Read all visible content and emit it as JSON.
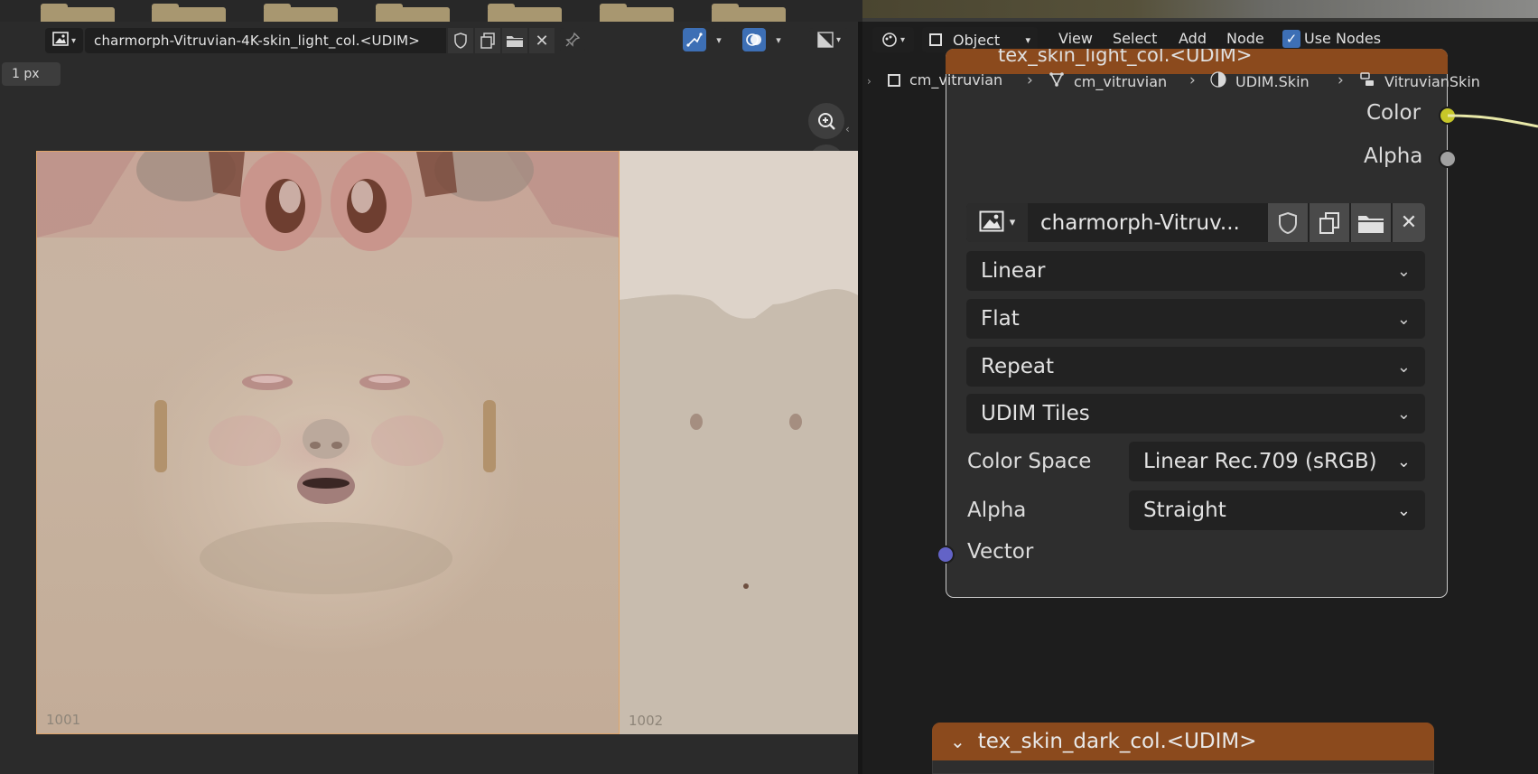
{
  "image_editor": {
    "image_name": "charmorph-Vitruvian-4K-skin_light_col.<UDIM>",
    "zoom_badge": "1 px",
    "tiles": [
      {
        "label": "1001"
      },
      {
        "label": "1002"
      }
    ]
  },
  "node_editor": {
    "mode": "Object",
    "menu": [
      "View",
      "Select",
      "Add",
      "Node"
    ],
    "use_nodes_label": "Use Nodes",
    "use_nodes_checked": true,
    "breadcrumb": [
      "cm_vitruvian",
      "cm_vitruvian",
      "UDIM.Skin",
      "VitruvianSkin"
    ],
    "image_node": {
      "title": "tex_skin_light_col.<UDIM>",
      "outputs": [
        "Color",
        "Alpha"
      ],
      "image_name": "charmorph-Vitruv...",
      "interpolation": "Linear",
      "projection": "Flat",
      "extension": "Repeat",
      "source": "UDIM Tiles",
      "color_space_label": "Color Space",
      "color_space_value": "Linear Rec.709 (sRGB)",
      "alpha_label": "Alpha",
      "alpha_value": "Straight",
      "input": "Vector"
    },
    "dark_node": {
      "title": "tex_skin_dark_col.<UDIM>"
    },
    "colors": {
      "node_header": "#8b4a1d",
      "color_socket": "#c7c729",
      "alpha_socket": "#a1a1a1",
      "vector_socket": "#6363c7",
      "accent_blue": "#3d6fb5"
    }
  }
}
